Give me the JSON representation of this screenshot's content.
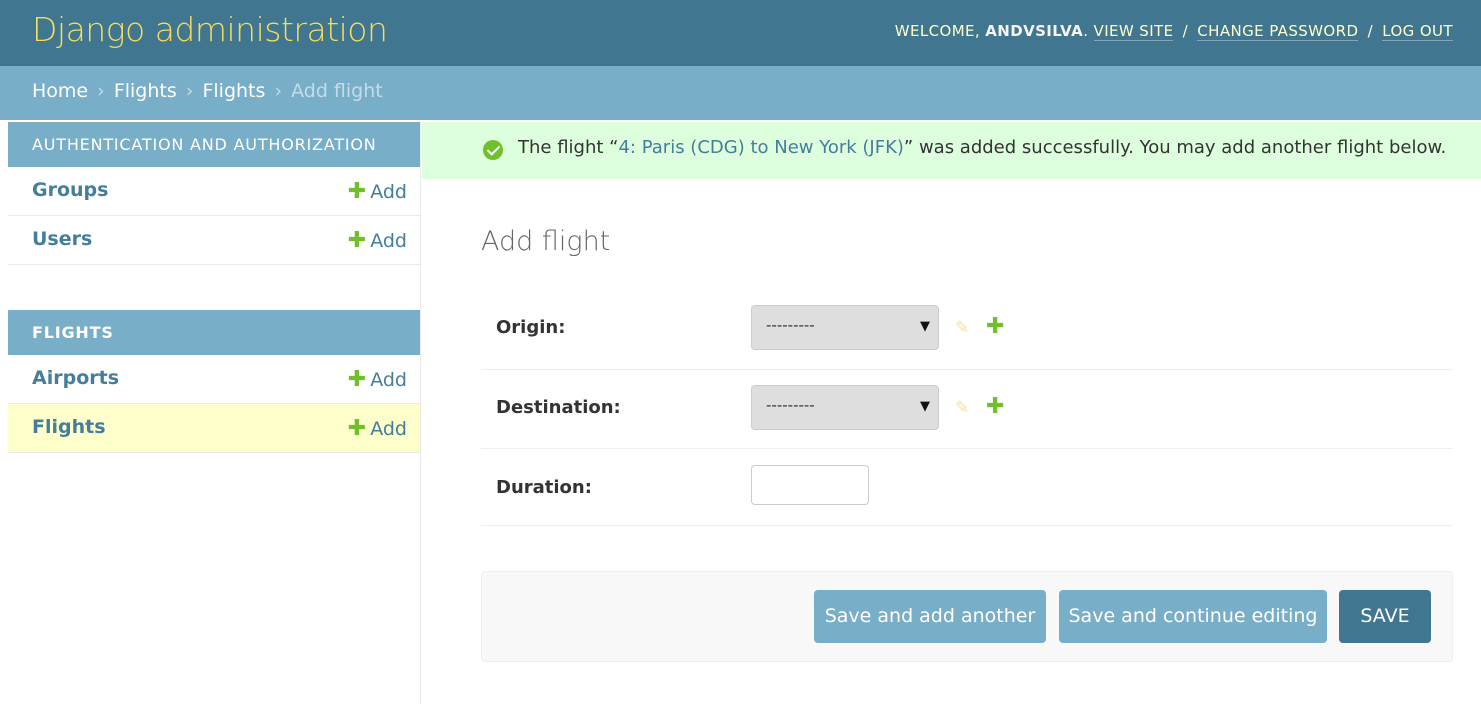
{
  "header": {
    "branding": "Django administration",
    "welcome": "WELCOME,",
    "username": "ANDVSILVA",
    "period": ".",
    "view_site": "VIEW SITE",
    "change_password": "CHANGE PASSWORD",
    "log_out": "LOG OUT",
    "separator": "/"
  },
  "breadcrumbs": {
    "items": [
      "Home",
      "Flights",
      "Flights"
    ],
    "current": "Add flight",
    "separator": "›"
  },
  "sidebar": {
    "modules": [
      {
        "caption": "Authentication and Authorization",
        "models": [
          {
            "name": "Groups",
            "add_label": "Add"
          },
          {
            "name": "Users",
            "add_label": "Add"
          }
        ]
      },
      {
        "caption": "Flights",
        "models": [
          {
            "name": "Airports",
            "add_label": "Add"
          },
          {
            "name": "Flights",
            "add_label": "Add",
            "current": true
          }
        ]
      }
    ]
  },
  "message": {
    "prefix": "The flight “",
    "link": "4: Paris (CDG) to New York (JFK)",
    "suffix": "” was added successfully. You may add another flight below."
  },
  "form": {
    "title": "Add flight",
    "origin": {
      "label": "Origin:",
      "value": "---------"
    },
    "destination": {
      "label": "Destination:",
      "value": "---------"
    },
    "duration": {
      "label": "Duration:",
      "value": ""
    }
  },
  "buttons": {
    "save_add_another": "Save and add another",
    "save_continue": "Save and continue editing",
    "save": "SAVE"
  },
  "icons": {
    "plus": "plus-icon",
    "edit": "pencil-icon",
    "success": "check-circle-icon",
    "dropdown": "chevron-down-icon"
  },
  "colors": {
    "header_bg": "#417690",
    "branding": "#f5dd5d",
    "breadcrumb_bg": "#79aec8",
    "link": "#447e9b",
    "add_plus": "#70bf2b",
    "success_bg": "#ddffdd",
    "current_row": "#ffffcc"
  }
}
